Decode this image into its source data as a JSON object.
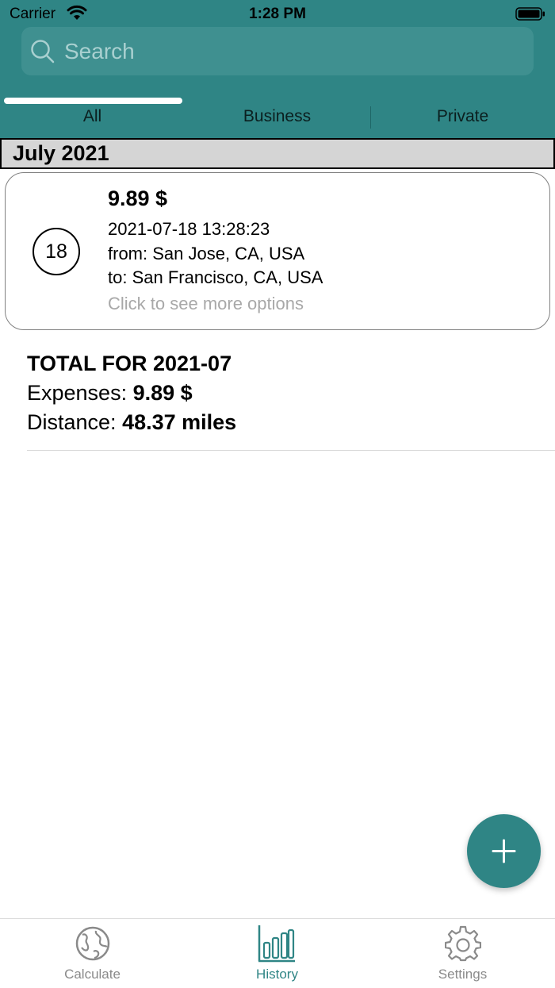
{
  "status_bar": {
    "carrier": "Carrier",
    "time": "1:28 PM"
  },
  "search": {
    "placeholder": "Search",
    "value": ""
  },
  "segments": [
    {
      "label": "All",
      "selected": true
    },
    {
      "label": "Business",
      "selected": false
    },
    {
      "label": "Private",
      "selected": false
    }
  ],
  "month": "July 2021",
  "trip": {
    "day": "18",
    "amount": "9.89 $",
    "datetime": "2021-07-18 13:28:23",
    "from": "from: San Jose, CA, USA",
    "to": "to: San Francisco, CA, USA",
    "hint": "Click to see more options"
  },
  "totals": {
    "title": "TOTAL FOR 2021-07",
    "expenses_label": "Expenses:",
    "expenses_value": "9.89 $",
    "distance_label": "Distance:",
    "distance_value": "48.37 miles"
  },
  "fab_icon": "plus-icon",
  "tabbar": {
    "items": [
      {
        "label": "Calculate",
        "icon": "globe-icon"
      },
      {
        "label": "History",
        "icon": "bar-chart-icon",
        "active": true
      },
      {
        "label": "Settings",
        "icon": "gear-icon"
      }
    ]
  },
  "colors": {
    "accent": "#2f8585",
    "search_bg": "#3f9090",
    "month_header_bg": "#d5d5d5"
  }
}
